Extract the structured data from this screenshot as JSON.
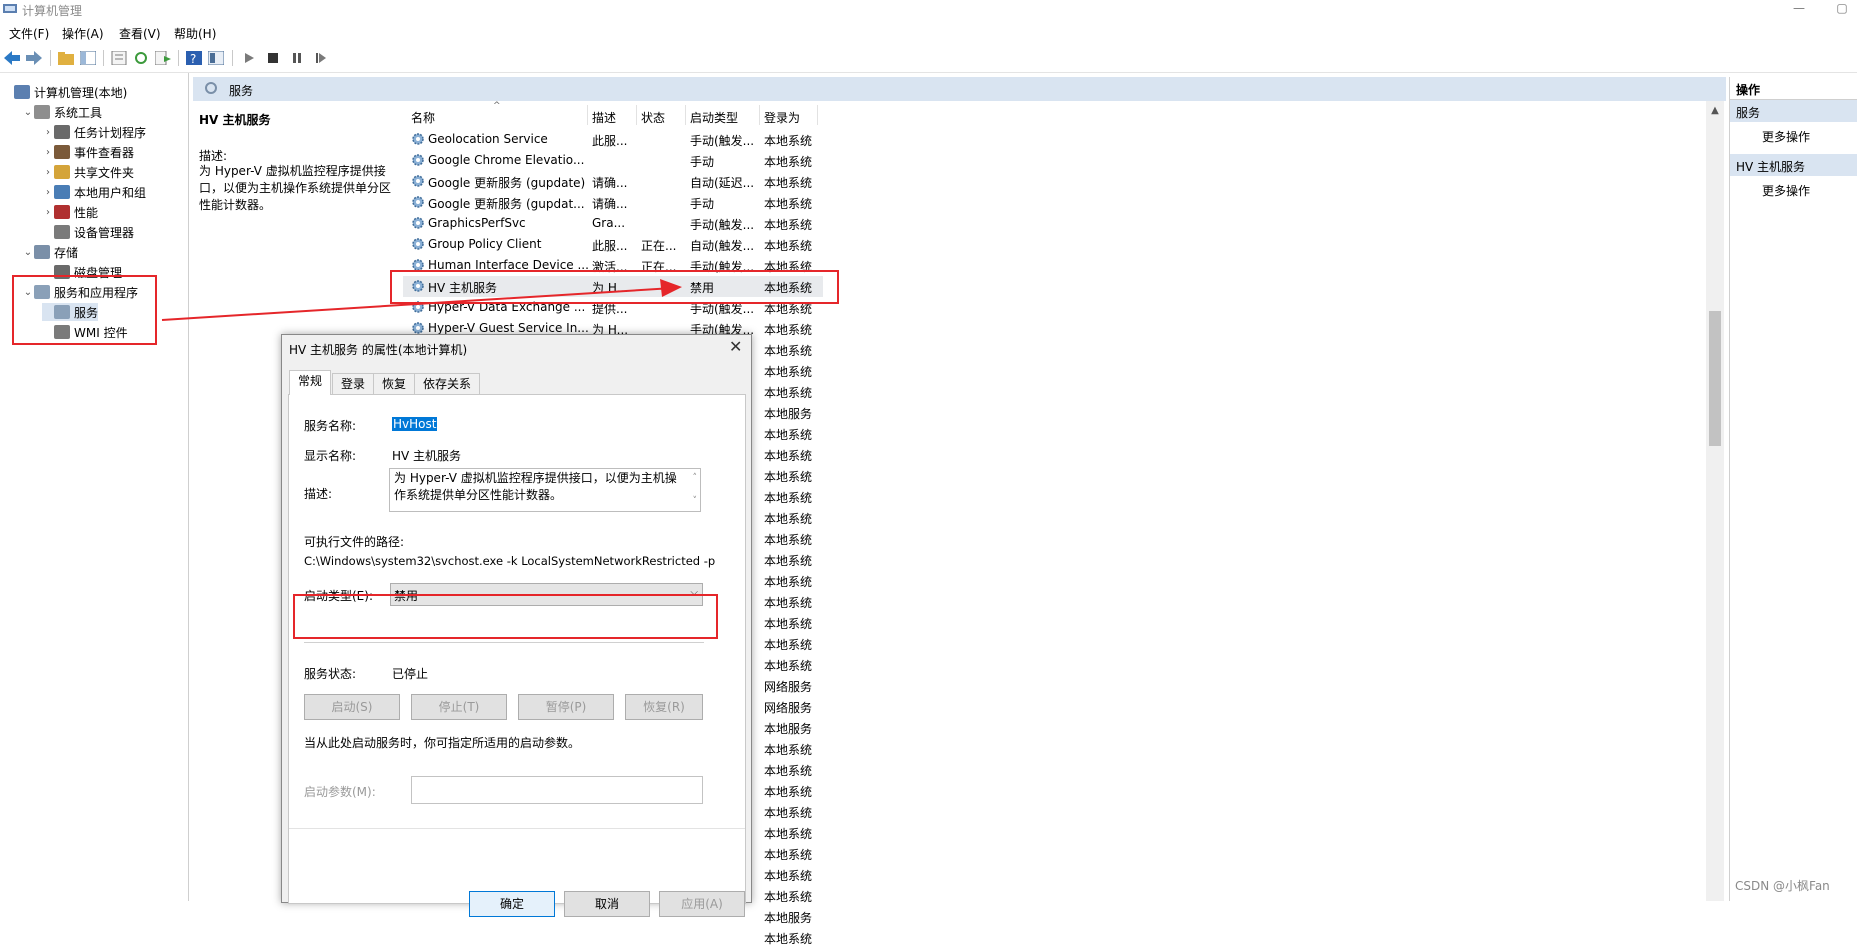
{
  "window": {
    "title": "计算机管理"
  },
  "menu": [
    "文件(F)",
    "操作(A)",
    "查看(V)",
    "帮助(H)"
  ],
  "tree": [
    {
      "label": "计算机管理(本地)",
      "indent": 0,
      "chev": "",
      "icon": "computer-management-icon",
      "color": "#5b7fb0"
    },
    {
      "label": "系统工具",
      "indent": 1,
      "chev": "⌄",
      "icon": "system-tools-icon",
      "color": "#8e8e8e"
    },
    {
      "label": "任务计划程序",
      "indent": 2,
      "chev": "›",
      "icon": "task-scheduler-icon",
      "color": "#6a6a6a"
    },
    {
      "label": "事件查看器",
      "indent": 2,
      "chev": "›",
      "icon": "event-viewer-icon",
      "color": "#7b5a3a"
    },
    {
      "label": "共享文件夹",
      "indent": 2,
      "chev": "›",
      "icon": "shared-folders-icon",
      "color": "#d4a43a"
    },
    {
      "label": "本地用户和组",
      "indent": 2,
      "chev": "›",
      "icon": "local-users-icon",
      "color": "#4a7db5"
    },
    {
      "label": "性能",
      "indent": 2,
      "chev": "›",
      "icon": "performance-icon",
      "color": "#b03030"
    },
    {
      "label": "设备管理器",
      "indent": 2,
      "chev": "",
      "icon": "device-manager-icon",
      "color": "#7a7a7a"
    },
    {
      "label": "存储",
      "indent": 1,
      "chev": "⌄",
      "icon": "storage-icon",
      "color": "#7a8fa8"
    },
    {
      "label": "磁盘管理",
      "indent": 2,
      "chev": "",
      "icon": "disk-management-icon",
      "color": "#6a6a6a"
    },
    {
      "label": "服务和应用程序",
      "indent": 1,
      "chev": "⌄",
      "icon": "services-apps-icon",
      "color": "#8aa0b8"
    },
    {
      "label": "服务",
      "indent": 2,
      "chev": "",
      "icon": "services-icon",
      "color": "#8aa0b8",
      "selected": true
    },
    {
      "label": "WMI 控件",
      "indent": 2,
      "chev": "",
      "icon": "wmi-control-icon",
      "color": "#7a7a7a"
    }
  ],
  "center": {
    "header": "服务",
    "selected_service": "HV 主机服务",
    "desc_label": "描述:",
    "desc_text": "为 Hyper-V 虚拟机监控程序提供接口，以便为主机操作系统提供单分区性能计数器。"
  },
  "columns": [
    "名称",
    "描述",
    "状态",
    "启动类型",
    "登录为"
  ],
  "services": [
    {
      "name": "Geolocation Service",
      "desc": "此服...",
      "status": "",
      "start": "手动(触发...",
      "logon": "本地系统"
    },
    {
      "name": "Google Chrome Elevatio...",
      "desc": "",
      "status": "",
      "start": "手动",
      "logon": "本地系统"
    },
    {
      "name": "Google 更新服务 (gupdate)",
      "desc": "请确...",
      "status": "",
      "start": "自动(延迟...",
      "logon": "本地系统"
    },
    {
      "name": "Google 更新服务 (gupdat...",
      "desc": "请确...",
      "status": "",
      "start": "手动",
      "logon": "本地系统"
    },
    {
      "name": "GraphicsPerfSvc",
      "desc": "Gra...",
      "status": "",
      "start": "手动(触发...",
      "logon": "本地系统"
    },
    {
      "name": "Group Policy Client",
      "desc": "此服...",
      "status": "正在...",
      "start": "自动(触发...",
      "logon": "本地系统"
    },
    {
      "name": "Human Interface Device ...",
      "desc": "激活...",
      "status": "正在...",
      "start": "手动(触发...",
      "logon": "本地系统"
    },
    {
      "name": "HV 主机服务",
      "desc": "为 H...",
      "status": "",
      "start": "禁用",
      "logon": "本地系统",
      "selected": true
    },
    {
      "name": "Hyper-V Data Exchange ...",
      "desc": "提供...",
      "status": "",
      "start": "手动(触发...",
      "logon": "本地系统"
    },
    {
      "name": "Hyper-V Guest Service In...",
      "desc": "为 H...",
      "status": "",
      "start": "手动(触发...",
      "logon": "本地系统"
    }
  ],
  "logon_rest": [
    "本地系统",
    "本地系统",
    "本地系统",
    "本地服务",
    "本地系统",
    "本地系统",
    "本地系统",
    "本地系统",
    "本地系统",
    "本地系统",
    "本地系统",
    "本地系统",
    "本地系统",
    "本地系统",
    "本地系统",
    "本地系统",
    "网络服务",
    "网络服务",
    "本地服务",
    "本地系统",
    "本地系统",
    "本地系统",
    "本地系统",
    "本地系统",
    "本地系统",
    "本地系统",
    "本地系统",
    "本地服务",
    "本地系统"
  ],
  "actions": {
    "section1": "操作",
    "group1": "服务",
    "more1": "更多操作",
    "group2": "HV 主机服务",
    "more2": "更多操作"
  },
  "dialog": {
    "title": "HV 主机服务 的属性(本地计算机)",
    "close": "✕",
    "tabs": [
      "常规",
      "登录",
      "恢复",
      "依存关系"
    ],
    "service_name_label": "服务名称:",
    "service_name": "HvHost",
    "display_name_label": "显示名称:",
    "display_name": "HV 主机服务",
    "desc_label": "描述:",
    "desc": "为 Hyper-V 虚拟机监控程序提供接口，以便为主机操作系统提供单分区性能计数器。",
    "path_label": "可执行文件的路径:",
    "path": "C:\\Windows\\system32\\svchost.exe -k LocalSystemNetworkRestricted -p",
    "startup_label": "启动类型(E):",
    "startup_value": "禁用",
    "status_label": "服务状态:",
    "status_value": "已停止",
    "buttons": [
      "启动(S)",
      "停止(T)",
      "暂停(P)",
      "恢复(R)"
    ],
    "hint": "当从此处启动服务时，你可指定所适用的启动参数。",
    "params_label": "启动参数(M):",
    "bottom_buttons": [
      "确定",
      "取消",
      "应用(A)"
    ]
  },
  "watermark": "CSDN @小枫Fan",
  "accent_red": "#e5262a",
  "selection_blue": "#0078d7"
}
